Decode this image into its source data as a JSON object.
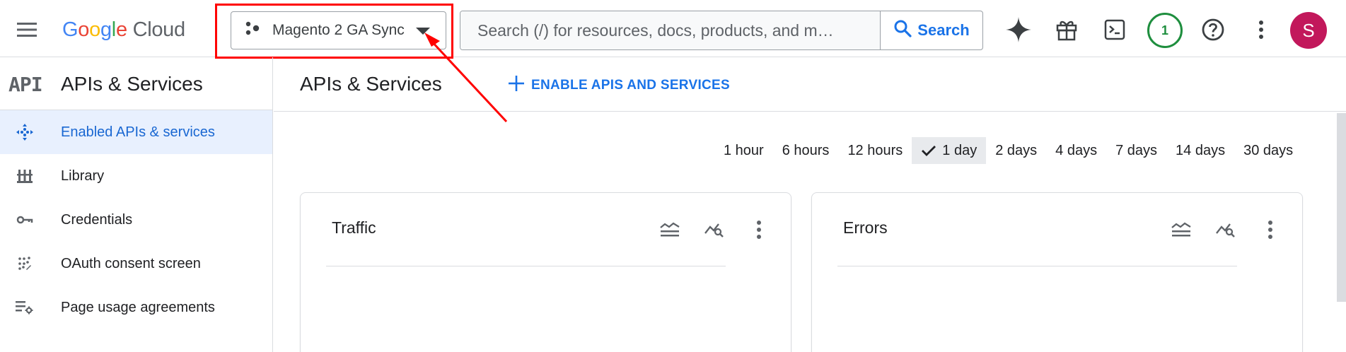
{
  "header": {
    "logo_google": [
      "G",
      "o",
      "o",
      "g",
      "l",
      "e"
    ],
    "logo_cloud": "Cloud",
    "project_name": "Magento 2 GA Sync",
    "search_placeholder": "Search (/) for resources, docs, products, and m…",
    "search_button": "Search",
    "notification_count": "1",
    "avatar_initial": "S",
    "icons": [
      "menu-icon",
      "project-icon",
      "search-icon",
      "gemini-icon",
      "gift-icon",
      "cloud-shell-icon",
      "help-icon",
      "more-vert-icon"
    ]
  },
  "sidebar": {
    "badge": "API",
    "title": "APIs & Services",
    "items": [
      {
        "label": "Enabled APIs & services",
        "icon": "diamond-dots-icon",
        "active": true
      },
      {
        "label": "Library",
        "icon": "library-icon",
        "active": false
      },
      {
        "label": "Credentials",
        "icon": "key-icon",
        "active": false
      },
      {
        "label": "OAuth consent screen",
        "icon": "dotted-grid-icon",
        "active": false
      },
      {
        "label": "Page usage agreements",
        "icon": "settings-list-icon",
        "active": false
      }
    ]
  },
  "main": {
    "title": "APIs & Services",
    "enable_button": "ENABLE APIS AND SERVICES",
    "time_range": {
      "options": [
        "1 hour",
        "6 hours",
        "12 hours",
        "1 day",
        "2 days",
        "4 days",
        "7 days",
        "14 days",
        "30 days"
      ],
      "selected": "1 day"
    },
    "cards": [
      {
        "title": "Traffic"
      },
      {
        "title": "Errors"
      }
    ]
  },
  "colors": {
    "accent": "#1a73e8",
    "annotation_red": "#ff0000",
    "notification_green": "#1e8e3e",
    "avatar_bg": "#c2185b",
    "active_nav_bg": "#e8f0fe"
  }
}
